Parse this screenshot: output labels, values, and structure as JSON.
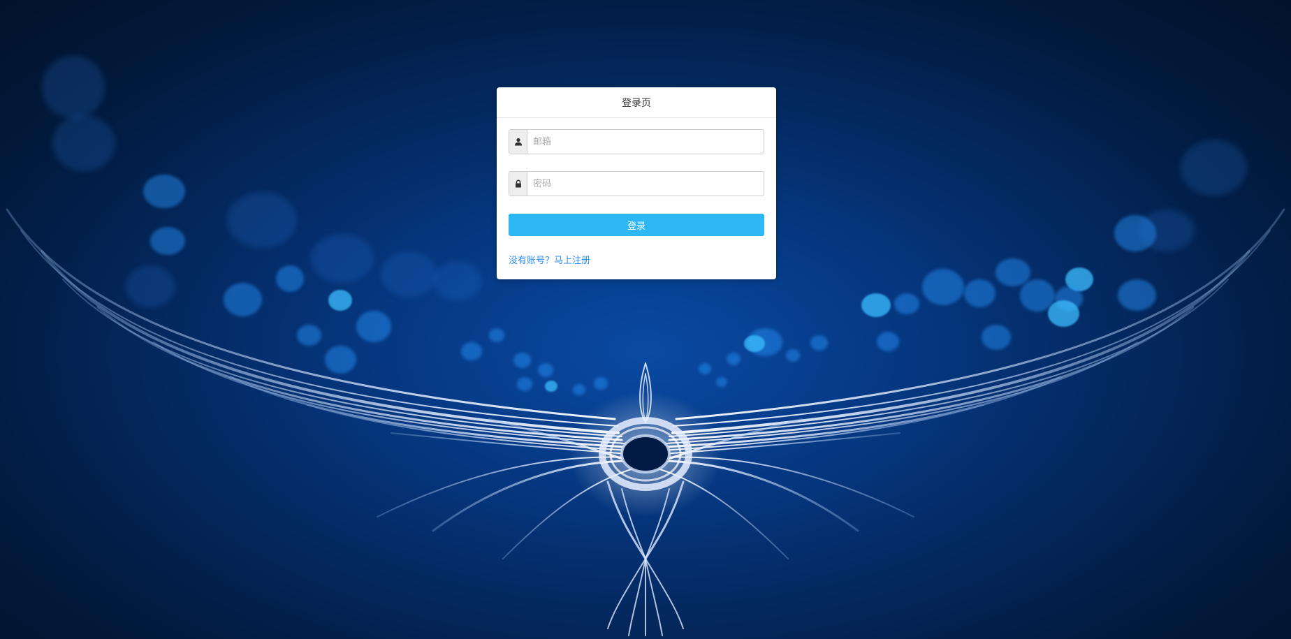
{
  "login_card": {
    "title": "登录页",
    "email_placeholder": "邮箱",
    "password_placeholder": "密码",
    "login_button": "登录",
    "register_link": "没有账号？马上注册"
  },
  "icons": {
    "email_addon": "user-icon",
    "password_addon": "lock-icon"
  },
  "colors": {
    "primary_button": "#2db7f5",
    "link": "#2d8cf0",
    "background_dark": "#021b40",
    "background_mid": "#063a86"
  }
}
